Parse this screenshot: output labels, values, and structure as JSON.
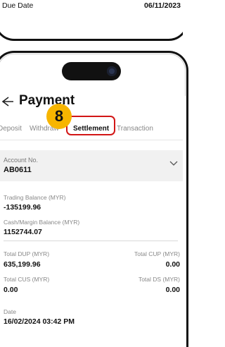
{
  "previous_screen": {
    "due_label": "Due Date",
    "due_value": "06/11/2023"
  },
  "header": {
    "title": "Payment"
  },
  "step_badge": "8",
  "tabs": [
    {
      "label": "Deposit"
    },
    {
      "label": "Withdraw"
    },
    {
      "label": "Settlement",
      "active": true
    },
    {
      "label": "Transaction"
    }
  ],
  "account": {
    "label": "Account No.",
    "value": "AB0611"
  },
  "balances": {
    "trading_label": "Trading Balance (MYR)",
    "trading_value": "-135199.96",
    "cash_label": "Cash/Margin Balance (MYR)",
    "cash_value": "1152744.07",
    "dup_label": "Total DUP (MYR)",
    "dup_value": "635,199.96",
    "cup_label": "Total CUP (MYR)",
    "cup_value": "0.00",
    "cus_label": "Total CUS (MYR)",
    "cus_value": "0.00",
    "ds_label": "Total DS (MYR)",
    "ds_value": "0.00",
    "date_label": "Date",
    "date_value": "16/02/2024 03:42 PM"
  },
  "colors": {
    "badge": "#f7b500",
    "highlight": "#d21616",
    "card_bg": "#f1f1f1"
  },
  "icons": [
    "back-arrow-icon",
    "chevron-down-icon",
    "camera-icon"
  ]
}
